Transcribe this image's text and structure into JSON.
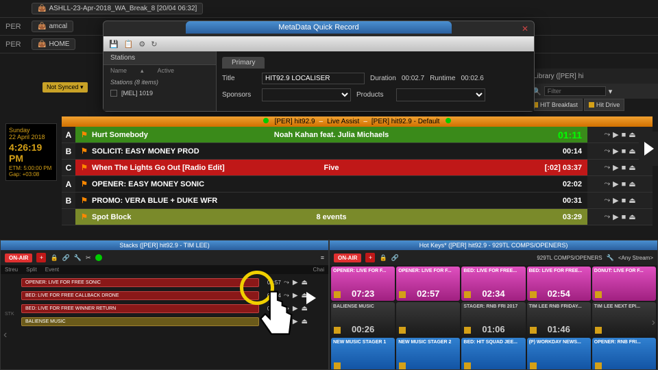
{
  "bg": {
    "rows": [
      {
        "label": "",
        "text": "ASHLL-23-Apr-2018_WA_Break_8 [20/04 06:32]"
      },
      {
        "label": "PER",
        "text": "amcal"
      },
      {
        "label": "PER",
        "text": "HOME"
      }
    ],
    "notsync": "Not Synced"
  },
  "library": {
    "title": "Library ([PER] hi",
    "filter_placeholder": "Filter",
    "tabs": [
      "HIT Breakfast",
      "Hit Drive"
    ]
  },
  "meta": {
    "title": "MetaData Quick Record",
    "tabs_left": "Stations",
    "cols": [
      "Name",
      "Active"
    ],
    "items_header": "Stations (8 items)",
    "item1": "[MEL] 1019",
    "tab_right": "Primary",
    "title_field_label": "Title",
    "title_value": "HIT92.9 LOCALISER",
    "duration_label": "Duration",
    "duration_value": "00:02.7",
    "runtime_label": "Runtime",
    "runtime_value": "00:02.6",
    "sponsors_label": "Sponsors",
    "products_label": "Products"
  },
  "clock": {
    "day": "Sunday",
    "date": "22 April 2018",
    "time": "4:26:19 PM",
    "etm": "ETM: 5:00:00 PM",
    "gap": "Gap:  +03:08"
  },
  "playout": {
    "header_left": "[PER] hit92.9",
    "mode": "Live Assist",
    "header_right": "[PER] hit92.9 - Default",
    "rows": [
      {
        "h": "A",
        "cls": "green",
        "title": "Hurt Somebody",
        "artist": "Noah Kahan feat. Julia Michaels",
        "time": "01:11"
      },
      {
        "h": "B",
        "cls": "black",
        "title": "SOLICIT: EASY MONEY PROD",
        "artist": "",
        "time": "00:14"
      },
      {
        "h": "C",
        "cls": "red",
        "title": "When The Lights Go Out [Radio Edit]",
        "artist": "Five",
        "time": "[:02]  03:37"
      },
      {
        "h": "A",
        "cls": "black",
        "title": "OPENER: EASY MONEY SONIC",
        "artist": "",
        "time": "02:02"
      },
      {
        "h": "B",
        "cls": "black",
        "title": "PROMO: VERA BLUE + DUKE WFR",
        "artist": "",
        "time": "00:31"
      },
      {
        "h": "",
        "cls": "olive",
        "title": "Spot Block",
        "artist": "8 events",
        "time": "03:29"
      }
    ]
  },
  "stacks": {
    "title": "Stacks ([PER] hit92.9 - TIM LEE)",
    "onair": "ON-AIR",
    "tabs": [
      "Streu",
      "Split",
      "Event"
    ],
    "chain": "Chai",
    "stk": "STK",
    "rows": [
      {
        "cls": "sred",
        "label": "OPENER: LIVE FOR FREE SONIC",
        "time": "02:57"
      },
      {
        "cls": "sred",
        "label": "BED: LIVE FOR FREE CALLBACK DRONE",
        "time": "02:34"
      },
      {
        "cls": "sred",
        "label": "BED: LIVE FOR FREE WINNER RETURN",
        "time": "02:54"
      },
      {
        "cls": "sgold",
        "label": "BALIENSE MUSIC",
        "time": ""
      }
    ]
  },
  "hotkeys": {
    "title": "Hot Keys* ([PER] hit92.9 - 929TL COMPS/OPENERS)",
    "onair": "ON-AIR",
    "selector": "929TL COMPS/OPENERS",
    "stream": "<Any Stream>",
    "cells": [
      {
        "cls": "pink",
        "label": "OPENER: LIVE FOR F...",
        "time": "07:23"
      },
      {
        "cls": "pink",
        "label": "OPENER: LIVE FOR F...",
        "time": "02:57"
      },
      {
        "cls": "pink",
        "label": "BED: LIVE FOR FREE...",
        "time": "02:34"
      },
      {
        "cls": "pink",
        "label": "BED: LIVE FOR FREE...",
        "time": "02:54"
      },
      {
        "cls": "pink",
        "label": "DONUT: LIVE FOR F...",
        "time": ""
      },
      {
        "cls": "dark",
        "label": "BALIENSE MUSIC",
        "time": "00:26"
      },
      {
        "cls": "dark",
        "label": "",
        "time": ""
      },
      {
        "cls": "dark",
        "label": "STAGER: RNB FRI 2017",
        "time": "01:06"
      },
      {
        "cls": "dark",
        "label": "TIM LEE RNB FRIDAY...",
        "time": "01:46"
      },
      {
        "cls": "dark",
        "label": "TIM LEE NEXT EPI...",
        "time": ""
      },
      {
        "cls": "blue",
        "label": "NEW MUSIC STAGER 1",
        "time": ""
      },
      {
        "cls": "blue",
        "label": "NEW MUSIC STAGER 2",
        "time": ""
      },
      {
        "cls": "blue",
        "label": "BED: HIT SQUAD JEE...",
        "time": ""
      },
      {
        "cls": "blue",
        "label": "(P) WORKDAY NEWS...",
        "time": ""
      },
      {
        "cls": "blue",
        "label": "OPENER: RNB FRI...",
        "time": ""
      }
    ]
  }
}
